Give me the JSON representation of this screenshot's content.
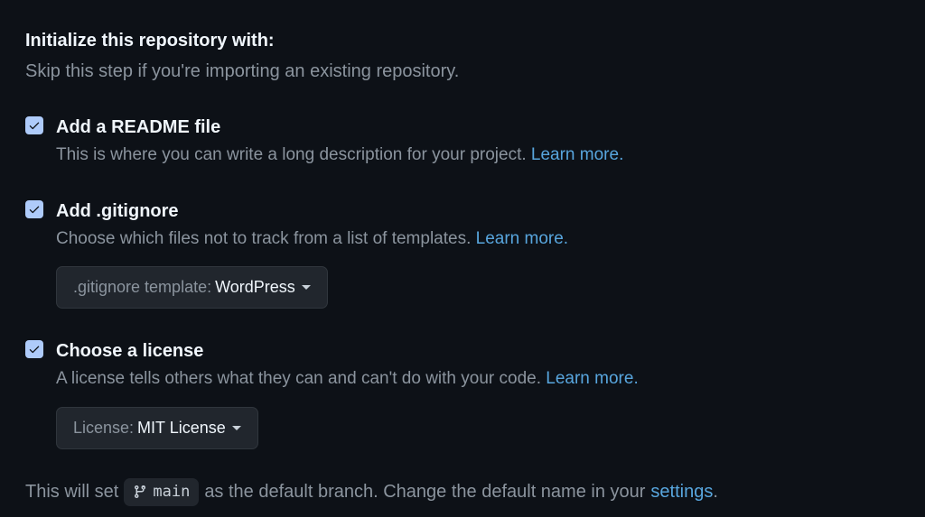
{
  "heading": "Initialize this repository with:",
  "subheading": "Skip this step if you're importing an existing repository.",
  "readme": {
    "title": "Add a README file",
    "desc": "This is where you can write a long description for your project. ",
    "learnMore": "Learn more."
  },
  "gitignore": {
    "title": "Add .gitignore",
    "desc": "Choose which files not to track from a list of templates. ",
    "learnMore": "Learn more.",
    "dropdownPrefix": ".gitignore template:",
    "dropdownValue": "WordPress"
  },
  "license": {
    "title": "Choose a license",
    "desc": "A license tells others what they can and can't do with your code. ",
    "learnMore": "Learn more.",
    "dropdownPrefix": "License:",
    "dropdownValue": "MIT License"
  },
  "footer": {
    "part1": "This will set",
    "branchName": "main",
    "part2": "as the default branch. Change the default name in your",
    "settingsLink": "settings",
    "period": "."
  }
}
